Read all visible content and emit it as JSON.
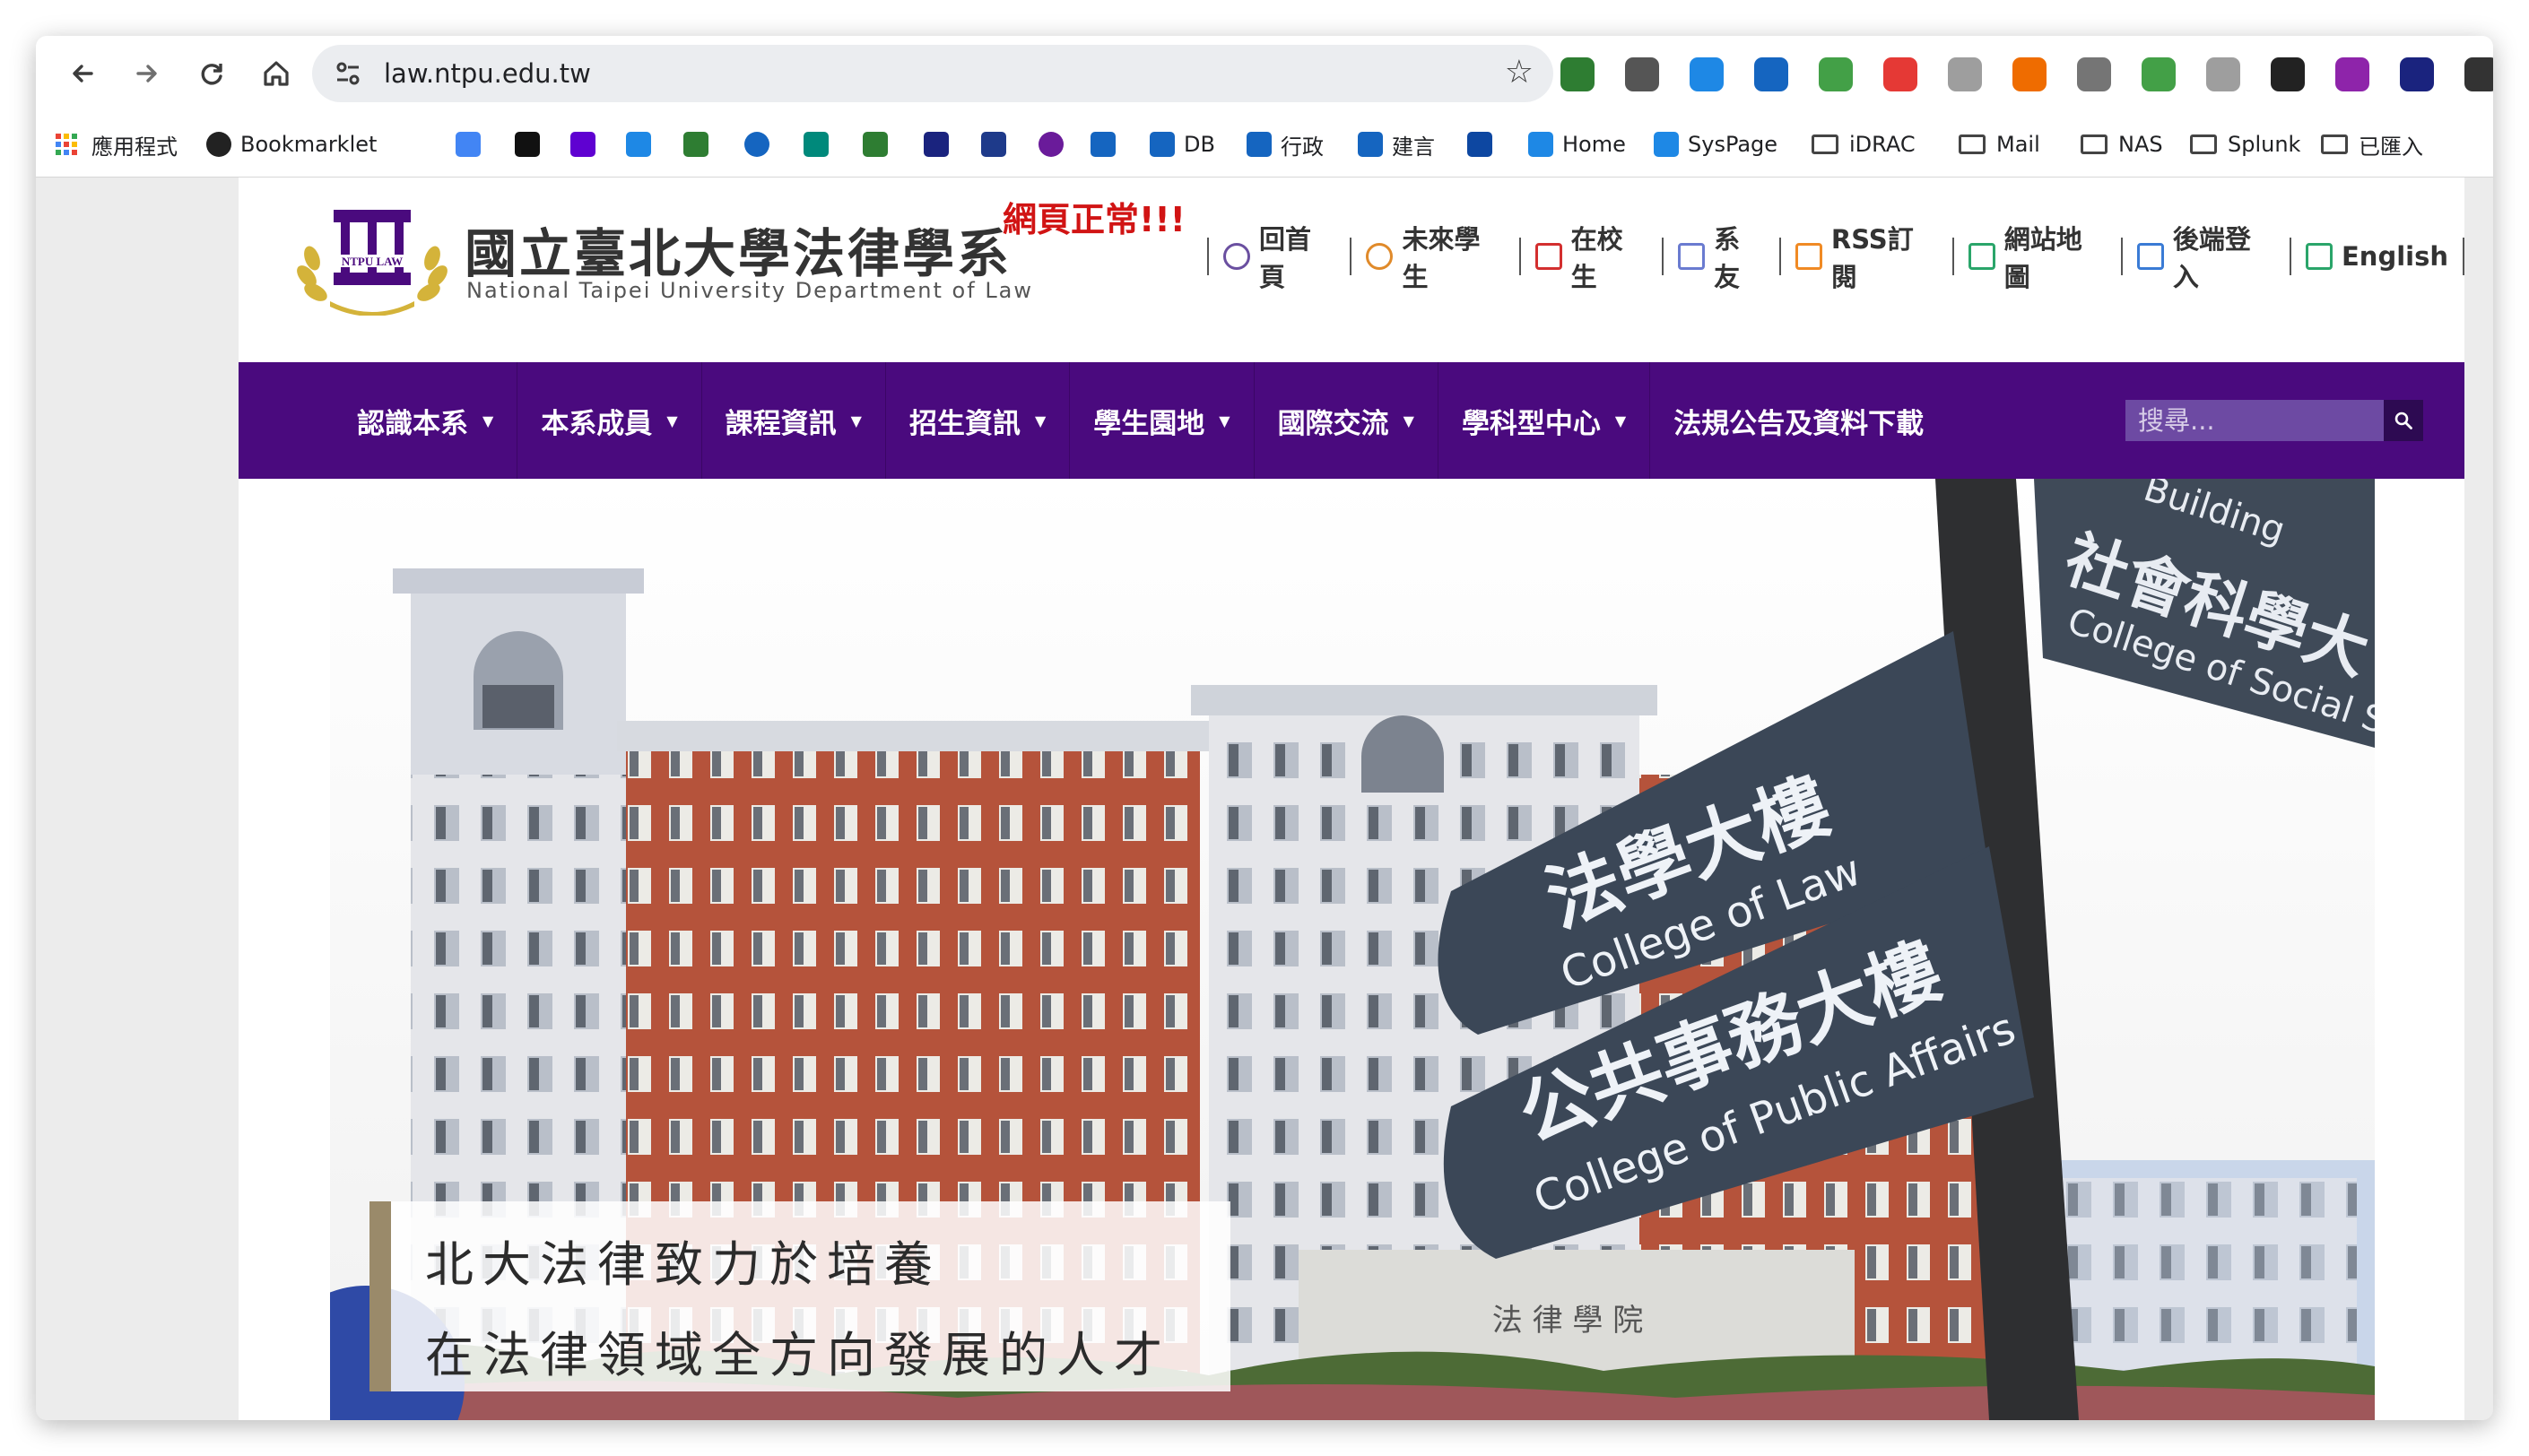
{
  "browser": {
    "url": "law.ntpu.edu.tw",
    "bookmarks": [
      {
        "label": "應用程式",
        "icon": "apps-grid-icon"
      },
      {
        "label": "Bookmarklet",
        "icon": "globe-icon"
      },
      {
        "label": "",
        "icon": "google-icon"
      },
      {
        "label": "",
        "icon": "star-icon"
      },
      {
        "label": "",
        "icon": "yahoo-icon"
      },
      {
        "label": "",
        "icon": "p-icon"
      },
      {
        "label": "",
        "icon": "green-app-icon"
      },
      {
        "label": "",
        "icon": "target-icon"
      },
      {
        "label": "",
        "icon": "chart-icon"
      },
      {
        "label": "",
        "icon": "arrows-icon"
      },
      {
        "label": "",
        "icon": "sigma-icon"
      },
      {
        "label": "",
        "icon": "stack-icon"
      },
      {
        "label": "",
        "icon": "badge-icon"
      },
      {
        "label": "",
        "icon": "edu-icon"
      },
      {
        "label": "DB",
        "icon": "edu-icon"
      },
      {
        "label": "行政",
        "icon": "e-icon"
      },
      {
        "label": "建言",
        "icon": "e-icon"
      },
      {
        "label": "",
        "icon": "wave-icon"
      },
      {
        "label": "Home",
        "icon": "flag-icon"
      },
      {
        "label": "SysPage",
        "icon": "flag-icon"
      },
      {
        "label": "iDRAC",
        "icon": "folder-icon"
      },
      {
        "label": "Mail",
        "icon": "folder-icon"
      },
      {
        "label": "NAS",
        "icon": "folder-icon"
      },
      {
        "label": "Splunk",
        "icon": "folder-icon"
      },
      {
        "label": "已匯入",
        "icon": "folder-icon"
      }
    ],
    "extension_colors": [
      "#2e7d32",
      "#555555",
      "#1e88e5",
      "#1565c0",
      "#43a047",
      "#e53935",
      "#9e9e9e",
      "#ef6c00",
      "#757575",
      "#43a047",
      "#9e9e9e",
      "#222222",
      "#8e24aa",
      "#1a237e",
      "#333333"
    ]
  },
  "site": {
    "logo_text": "NTPU LAW",
    "title": "國立臺北大學法律學系",
    "subtitle": "National Taipei University Department of Law",
    "status": "網頁正常!!!",
    "top_links": [
      {
        "label": "回首頁",
        "icon": "globe-icon",
        "color": "#6a4fa0"
      },
      {
        "label": "未來學生",
        "icon": "user-icon",
        "color": "#e08a2a"
      },
      {
        "label": "在校生",
        "icon": "graduation-cap-icon",
        "color": "#d32f2f"
      },
      {
        "label": "系友",
        "icon": "paper-plane-icon",
        "color": "#6a7bd0"
      },
      {
        "label": "RSS訂閱",
        "icon": "rss-icon",
        "color": "#f08a24"
      },
      {
        "label": "網站地圖",
        "icon": "map-icon",
        "color": "#2aa56a"
      },
      {
        "label": "後端登入",
        "icon": "pencil-icon",
        "color": "#3a7bd5"
      },
      {
        "label": "English",
        "icon": "bookmark-icon",
        "color": "#2aa56a"
      }
    ],
    "menu": [
      {
        "label": "認識本系",
        "dropdown": true
      },
      {
        "label": "本系成員",
        "dropdown": true
      },
      {
        "label": "課程資訊",
        "dropdown": true
      },
      {
        "label": "招生資訊",
        "dropdown": true
      },
      {
        "label": "學生園地",
        "dropdown": true
      },
      {
        "label": "國際交流",
        "dropdown": true
      },
      {
        "label": "學科型中心",
        "dropdown": true
      },
      {
        "label": "法規公告及資料下載",
        "dropdown": false
      }
    ],
    "search_placeholder": "搜尋...",
    "hero": {
      "caption_line1": "北大法律致力於培養",
      "caption_line2": "在法律領域全方向發展的人才",
      "sign_top_cn": "社會科學大",
      "sign_top_en": "College of Social Sci",
      "sign_top_partial": "Building",
      "sign_law_cn": "法學大樓",
      "sign_law_en": "College of Law",
      "sign_public_cn": "公共事務大樓",
      "sign_public_en": "College of Public Affairs",
      "building_plaque": "法 律 學 院"
    }
  }
}
